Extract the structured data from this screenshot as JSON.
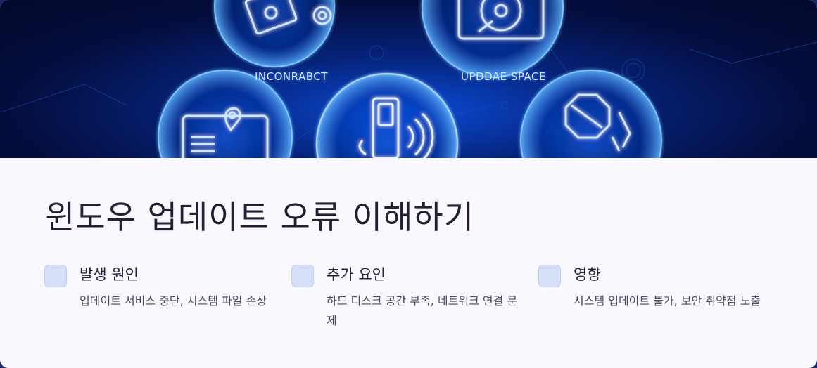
{
  "hero": {
    "label_left": "INCONRABCT",
    "label_right": "UPDDAE SPACE"
  },
  "title": "윈도우 업데이트 오류 이해하기",
  "features": [
    {
      "title": "발생 원인",
      "description": "업데이트 서비스 중단, 시스템 파일 손상"
    },
    {
      "title": "추가 요인",
      "description": "하드 디스크 공간 부족, 네트워크 연결 문제"
    },
    {
      "title": "영향",
      "description": "시스템 업데이트 불가, 보안 취약점 노출"
    }
  ],
  "colors": {
    "hero_dark": "#040d3c",
    "hero_glow": "#0a4bd6",
    "neon": "#5fb4ff",
    "card_bg": "#f8f8fe",
    "checkbox": "#d5dff8",
    "title_text": "#202030"
  },
  "icons": [
    "document-gear-icon",
    "hard-disk-icon",
    "location-document-icon",
    "phone-signal-icon",
    "broken-stop-icon"
  ]
}
